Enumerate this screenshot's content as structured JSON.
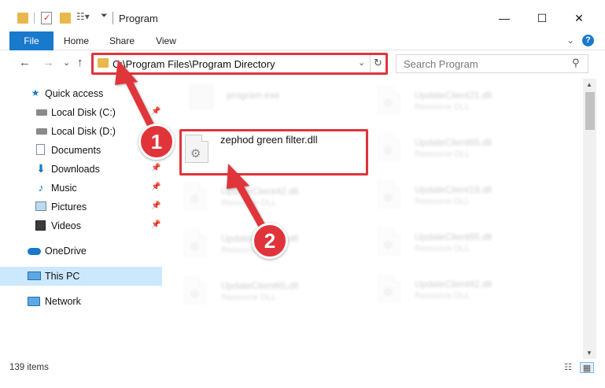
{
  "window": {
    "title": "Program",
    "minimize": "—",
    "maximize": "☐",
    "close": "✕"
  },
  "ribbon": {
    "tabs": [
      {
        "label": "File"
      },
      {
        "label": "Home"
      },
      {
        "label": "Share"
      },
      {
        "label": "View"
      }
    ],
    "expand": "⌄",
    "help": "?"
  },
  "nav": {
    "back": "←",
    "forward": "→",
    "recent": "⌄",
    "up": "↑",
    "address": "C:\\Program Files\\Program Directory",
    "address_dropdown": "⌄",
    "refresh": "↻",
    "search_placeholder": "Search Program"
  },
  "sidebar": {
    "items": [
      {
        "label": "Quick access",
        "icon": "star-icon",
        "pinned": false
      },
      {
        "label": "Local Disk (C:)",
        "icon": "drive-icon",
        "pinned": true
      },
      {
        "label": "Local Disk (D:)",
        "icon": "drive-icon",
        "pinned": false
      },
      {
        "label": "Documents",
        "icon": "documents-icon",
        "pinned": true
      },
      {
        "label": "Downloads",
        "icon": "download-icon",
        "pinned": true
      },
      {
        "label": "Music",
        "icon": "music-icon",
        "pinned": true
      },
      {
        "label": "Pictures",
        "icon": "pictures-icon",
        "pinned": true
      },
      {
        "label": "Videos",
        "icon": "videos-icon",
        "pinned": true
      },
      {
        "label": "OneDrive",
        "icon": "cloud-icon",
        "pinned": false
      },
      {
        "label": "This PC",
        "icon": "computer-icon",
        "pinned": false,
        "selected": true
      },
      {
        "label": "Network",
        "icon": "network-icon",
        "pinned": false
      }
    ]
  },
  "files": {
    "main": {
      "name": "zephod green filter.dll"
    },
    "left": [
      {
        "name": "program.exe",
        "type": ""
      },
      {
        "name": "UpdateClient42.dll",
        "type": "Resource DLL"
      },
      {
        "name": "UpdateClient65.dll",
        "type": "Resource DLL"
      },
      {
        "name": "UpdateClient65.dll",
        "type": "Resource DLL"
      }
    ],
    "right": [
      {
        "name": "UpdateClient21.dll",
        "type": "Resource DLL"
      },
      {
        "name": "UpdateClient65.dll",
        "type": "Resource DLL"
      },
      {
        "name": "UpdateClient19.dll",
        "type": "Resource DLL"
      },
      {
        "name": "UpdateClient65.dll",
        "type": "Resource DLL"
      },
      {
        "name": "UpdateClient42.dll",
        "type": "Resource DLL"
      }
    ]
  },
  "annotations": {
    "step1": "1",
    "step2": "2",
    "color": "#e0343a"
  },
  "status": {
    "item_count": "139 items"
  }
}
